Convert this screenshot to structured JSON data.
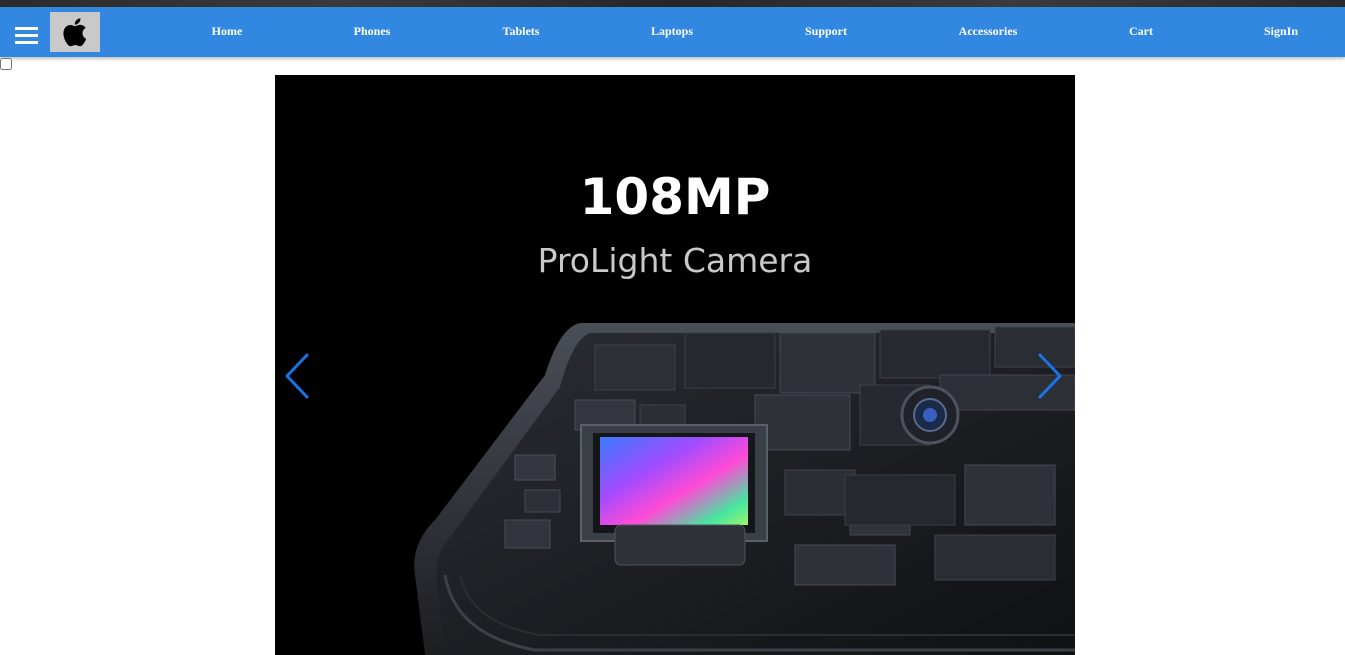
{
  "navbar": {
    "background_color": "#3287e0",
    "menu_icon": "hamburger-menu-icon",
    "logo_icon": "apple-logo-icon",
    "links": [
      {
        "label": "Home"
      },
      {
        "label": "Phones"
      },
      {
        "label": "Tablets"
      },
      {
        "label": "Laptops"
      },
      {
        "label": "Support"
      },
      {
        "label": "Accessories"
      },
      {
        "label": "Cart"
      },
      {
        "label": "SignIn"
      }
    ]
  },
  "menu_toggle": {
    "checked": false
  },
  "slider": {
    "slide": {
      "headline": "108MP",
      "subheadline": "ProLight Camera"
    },
    "prev_icon": "chevron-left-icon",
    "next_icon": "chevron-right-icon",
    "arrow_color": "#1a73e8"
  }
}
